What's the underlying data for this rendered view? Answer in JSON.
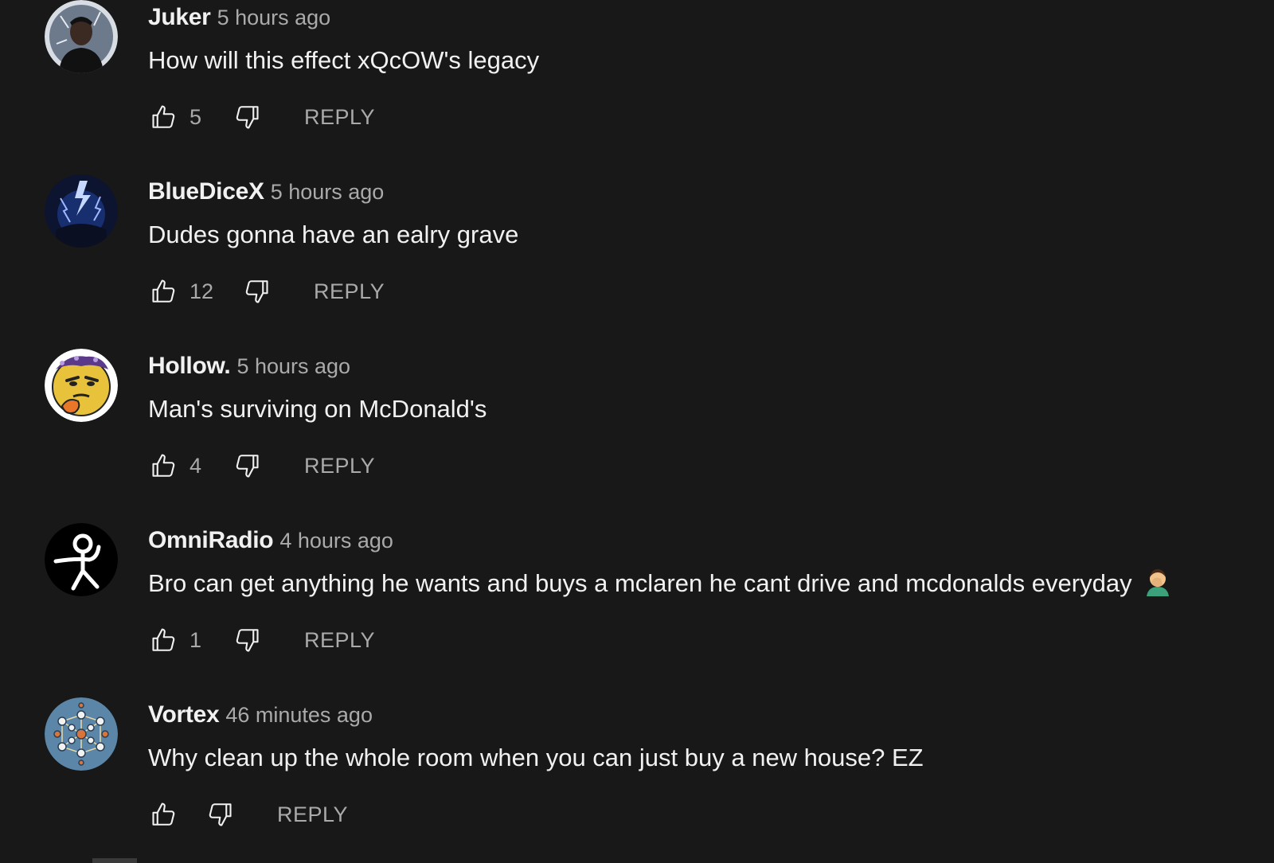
{
  "comments": [
    {
      "author": "Juker",
      "time": "5 hours ago",
      "text": "How will this effect xQcOW's legacy",
      "likes": "5",
      "reply_label": "REPLY",
      "avatar_icon": "person-dark-avatar"
    },
    {
      "author": "BlueDiceX",
      "time": "5 hours ago",
      "text": "Dudes gonna have an ealry grave",
      "likes": "12",
      "reply_label": "REPLY",
      "avatar_icon": "lightning-storm-avatar"
    },
    {
      "author": "Hollow.",
      "time": "5 hours ago",
      "text": "Man's surviving on McDonald's",
      "likes": "4",
      "reply_label": "REPLY",
      "avatar_icon": "thinking-face-avatar"
    },
    {
      "author": "OmniRadio",
      "time": "4 hours ago",
      "text": "Bro can get anything he wants and buys a mclaren he cant drive and mcdonalds everyday",
      "likes": "1",
      "reply_label": "REPLY",
      "avatar_icon": "stick-figure-avatar",
      "emoji": "man-facepalming-emoji"
    },
    {
      "author": "Vortex",
      "time": "46 minutes ago",
      "text": "Why clean up the whole room when you can just buy a new house? EZ",
      "likes": "",
      "reply_label": "REPLY",
      "avatar_icon": "dot-grid-avatar"
    }
  ],
  "colors": {
    "background": "#181818",
    "text_primary": "#f1f1f1",
    "text_secondary": "#aaaaaa"
  }
}
